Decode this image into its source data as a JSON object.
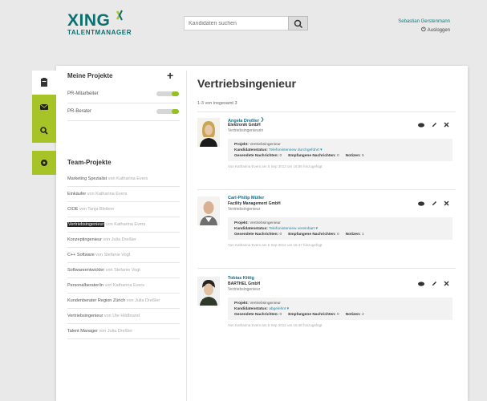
{
  "header": {
    "logo_word": "XING",
    "logo_sub": "TALENTMANAGER",
    "search_placeholder": "Kandidaten suchen",
    "user_name": "Sebastian Gerstenmann",
    "logout_label": "Ausloggen"
  },
  "sidebar": {
    "my_projects_title": "Meine Projekte",
    "my_projects": [
      {
        "label": "PR-Mitarbeiter"
      },
      {
        "label": "PR-Berater"
      }
    ],
    "team_title": "Team-Projekte",
    "team_projects": [
      {
        "name": "Marketing Spezialist",
        "owner": "von Katharina Evers"
      },
      {
        "name": "Einkäufer",
        "owner": "von Katharina Evers"
      },
      {
        "name": "CIOE",
        "owner": "von Tanja Bleibon"
      },
      {
        "name": "Vertriebsingenieur",
        "owner": "von Katharina Evers"
      },
      {
        "name": "Konzeptingenieur",
        "owner": "von Julia Dreßler"
      },
      {
        "name": "C++ Software",
        "owner": "von Stefanie Vogt"
      },
      {
        "name": "Softwareentwickler",
        "owner": "von Stefanie Vogt"
      },
      {
        "name": "Personalberater/in",
        "owner": "von Katharina Evers"
      },
      {
        "name": "Kundenberater Region Zürich",
        "owner": "von Julia Dreßler"
      },
      {
        "name": "Vertriebsingenieur",
        "owner": "von Ute Hildbrand"
      },
      {
        "name": "Talent Manager",
        "owner": "von Julia Dreßler"
      }
    ]
  },
  "main": {
    "title": "Vertriebsingenieur",
    "count_text": "1-3 von insgesamt 3",
    "labels": {
      "projekt": "Projekt:",
      "status": "Kandidatenstatus:",
      "sent": "Gesendete Nachrichten:",
      "received": "Empfangene Nachrichten:",
      "notes": "Notizen:"
    },
    "candidates": [
      {
        "name": "Angela Dreßler",
        "company": "Elektronik GmbH",
        "role": "Vertriebsingenieurin",
        "project": "Vertriebsingenieur",
        "status": "Telefoninterview durchgeführt",
        "sent": "0",
        "received": "0",
        "notes": "5",
        "footer": "Von Katharina Evers am 5 Sep 2012 um 16:56 hinzugefügt"
      },
      {
        "name": "Carl-Philip Müller",
        "company": "Facility Management GmbH",
        "role": "Vertriebsingenieur",
        "project": "Vertriebsingenieur",
        "status": "Telefoninterview vereinbart",
        "sent": "0",
        "received": "0",
        "notes": "1",
        "footer": "Von Katharina Evers am 5 Sep 2012 um 16:47 hinzugefügt"
      },
      {
        "name": "Tobias Kittig",
        "company": "BARTHEL GmbH",
        "role": "Vertriebsingenieur",
        "project": "Vertriebsingenieur",
        "status": "abgelehnt",
        "sent": "0",
        "received": "0",
        "notes": "2",
        "footer": "Von Katharina Evers am 5 Sep 2012 um 16:48 hinzugefügt"
      }
    ]
  },
  "colors": {
    "brand_teal": "#0a6f6e",
    "accent_green": "#a6c428",
    "link_blue": "#1e86a8"
  },
  "icons": [
    "xing-logo-icon",
    "search-icon",
    "power-icon",
    "clipboard-icon",
    "mail-icon",
    "magnifier-icon",
    "gear-icon",
    "message-icon",
    "pencil-icon",
    "close-icon"
  ]
}
